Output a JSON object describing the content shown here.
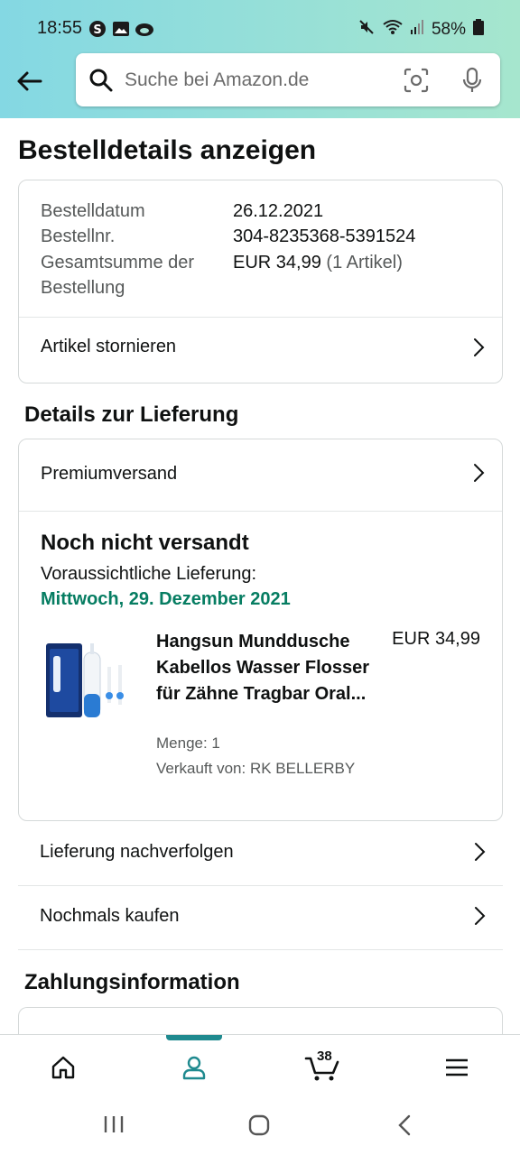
{
  "status_bar": {
    "time": "18:55",
    "battery": "58%",
    "icons_left": [
      "shazam-icon",
      "gallery-icon",
      "cloud-icon"
    ],
    "icons_right": [
      "mute-icon",
      "wifi-icon",
      "signal-icon",
      "battery-icon"
    ]
  },
  "header": {
    "search_placeholder": "Suche bei Amazon.de"
  },
  "page": {
    "title": "Bestelldetails anzeigen"
  },
  "order_summary": {
    "date_label": "Bestelldatum",
    "date_value": "26.12.2021",
    "number_label": "Bestellnr.",
    "number_value": "304-8235368-5391524",
    "total_label_1": "Gesamtsumme der",
    "total_label_2": "Bestellung",
    "total_value": "EUR 34,99",
    "total_items": "(1 Artikel)",
    "cancel_label": "Artikel stornieren"
  },
  "delivery": {
    "section_title": "Details zur Lieferung",
    "shipping_type": "Premiumversand",
    "status": "Noch nicht versandt",
    "eta_label": "Voraussichtliche Lieferung:",
    "eta_date": "Mittwoch, 29. Dezember 2021",
    "product": {
      "title": "Hangsun Mund­dusche Kabellos Wasser Flosser für Zähne Tragbar Oral...",
      "price": "EUR 34,99",
      "quantity": "Menge: 1",
      "seller": "Verkauft von: RK BELLERBY"
    }
  },
  "actions": {
    "track": "Lieferung nachverfolgen",
    "buy_again": "Nochmals kaufen"
  },
  "payment": {
    "section_title": "Zahlungsinformation"
  },
  "bottom_nav": {
    "cart_count": "38"
  },
  "colors": {
    "header_start": "#84d8e3",
    "header_end": "#a6e6ce",
    "eta_green": "#067d62",
    "active_teal": "#1f8a8f"
  }
}
